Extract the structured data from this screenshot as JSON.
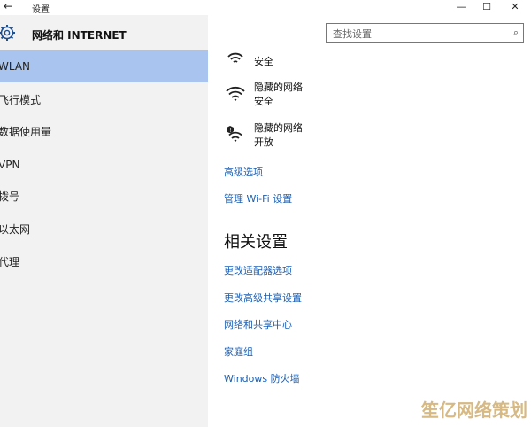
{
  "window": {
    "title": "设置",
    "back_icon": "back-arrow-icon",
    "minimize": "—",
    "maximize": "☐",
    "close": "✕"
  },
  "sidebar": {
    "header": "网络和 INTERNET",
    "items": [
      {
        "label": "WLAN",
        "selected": true
      },
      {
        "label": "飞行模式",
        "selected": false
      },
      {
        "label": "数据使用量",
        "selected": false
      },
      {
        "label": "VPN",
        "selected": false
      },
      {
        "label": "拨号",
        "selected": false
      },
      {
        "label": "以太网",
        "selected": false
      },
      {
        "label": "代理",
        "selected": false
      }
    ]
  },
  "search": {
    "placeholder": "查找设置",
    "icon": "⌕"
  },
  "networks": [
    {
      "name": "",
      "status": "安全",
      "shield": false
    },
    {
      "name": "隐藏的网络",
      "status": "安全",
      "shield": false
    },
    {
      "name": "隐藏的网络",
      "status": "开放",
      "shield": true
    }
  ],
  "links_top": {
    "advanced": "高级选项",
    "manage_wifi": "管理 Wi-Fi 设置"
  },
  "related": {
    "title": "相关设置",
    "links": [
      "更改适配器选项",
      "更改高级共享设置",
      "网络和共享中心",
      "家庭组",
      "Windows 防火墙"
    ]
  },
  "watermark": "笙亿网络策划",
  "colors": {
    "accent_link": "#1a5fb4",
    "selected_bg": "#a9c4ef",
    "sidebar_bg": "#f2f2f2"
  }
}
